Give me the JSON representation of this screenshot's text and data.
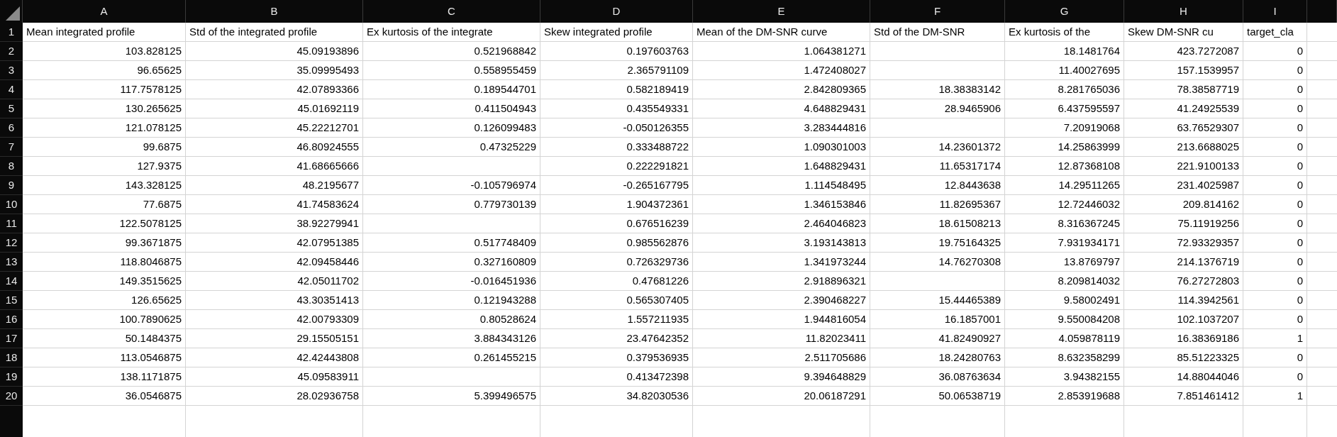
{
  "column_letters": [
    "A",
    "B",
    "C",
    "D",
    "E",
    "F",
    "G",
    "H",
    "I"
  ],
  "header_row": {
    "number": "1",
    "cells": [
      "Mean integrated profile",
      "Std of the integrated profile",
      "Ex kurtosis of the integrate",
      "Skew integrated profile",
      "Mean of the DM-SNR curve",
      "Std of the DM-SNR",
      "Ex kurtosis of the",
      "Skew DM-SNR cu",
      "target_cla"
    ]
  },
  "rows": [
    {
      "number": "2",
      "cells": [
        "103.828125",
        "45.09193896",
        "0.521968842",
        "0.197603763",
        "1.064381271",
        null,
        "18.1481764",
        "423.7272087",
        "0"
      ]
    },
    {
      "number": "3",
      "cells": [
        "96.65625",
        "35.09995493",
        "0.558955459",
        "2.365791109",
        "1.472408027",
        null,
        "11.40027695",
        "157.1539957",
        "0"
      ]
    },
    {
      "number": "4",
      "cells": [
        "117.7578125",
        "42.07893366",
        "0.189544701",
        "0.582189419",
        "2.842809365",
        "18.38383142",
        "8.281765036",
        "78.38587719",
        "0"
      ]
    },
    {
      "number": "5",
      "cells": [
        "130.265625",
        "45.01692119",
        "0.411504943",
        "0.435549331",
        "4.648829431",
        "28.9465906",
        "6.437595597",
        "41.24925539",
        "0"
      ]
    },
    {
      "number": "6",
      "cells": [
        "121.078125",
        "45.22212701",
        "0.126099483",
        "-0.050126355",
        "3.283444816",
        null,
        "7.20919068",
        "63.76529307",
        "0"
      ]
    },
    {
      "number": "7",
      "cells": [
        "99.6875",
        "46.80924555",
        "0.47325229",
        "0.333488722",
        "1.090301003",
        "14.23601372",
        "14.25863999",
        "213.6688025",
        "0"
      ]
    },
    {
      "number": "8",
      "cells": [
        "127.9375",
        "41.68665666",
        null,
        "0.222291821",
        "1.648829431",
        "11.65317174",
        "12.87368108",
        "221.9100133",
        "0"
      ]
    },
    {
      "number": "9",
      "cells": [
        "143.328125",
        "48.2195677",
        "-0.105796974",
        "-0.265167795",
        "1.114548495",
        "12.8443638",
        "14.29511265",
        "231.4025987",
        "0"
      ]
    },
    {
      "number": "10",
      "cells": [
        "77.6875",
        "41.74583624",
        "0.779730139",
        "1.904372361",
        "1.346153846",
        "11.82695367",
        "12.72446032",
        "209.814162",
        "0"
      ]
    },
    {
      "number": "11",
      "cells": [
        "122.5078125",
        "38.92279941",
        null,
        "0.676516239",
        "2.464046823",
        "18.61508213",
        "8.316367245",
        "75.11919256",
        "0"
      ]
    },
    {
      "number": "12",
      "cells": [
        "99.3671875",
        "42.07951385",
        "0.517748409",
        "0.985562876",
        "3.193143813",
        "19.75164325",
        "7.931934171",
        "72.93329357",
        "0"
      ]
    },
    {
      "number": "13",
      "cells": [
        "118.8046875",
        "42.09458446",
        "0.327160809",
        "0.726329736",
        "1.341973244",
        "14.76270308",
        "13.8769797",
        "214.1376719",
        "0"
      ]
    },
    {
      "number": "14",
      "cells": [
        "149.3515625",
        "42.05011702",
        "-0.016451936",
        "0.47681226",
        "2.918896321",
        null,
        "8.209814032",
        "76.27272803",
        "0"
      ]
    },
    {
      "number": "15",
      "cells": [
        "126.65625",
        "43.30351413",
        "0.121943288",
        "0.565307405",
        "2.390468227",
        "15.44465389",
        "9.58002491",
        "114.3942561",
        "0"
      ]
    },
    {
      "number": "16",
      "cells": [
        "100.7890625",
        "42.00793309",
        "0.80528624",
        "1.557211935",
        "1.944816054",
        "16.1857001",
        "9.550084208",
        "102.1037207",
        "0"
      ]
    },
    {
      "number": "17",
      "cells": [
        "50.1484375",
        "29.15505151",
        "3.884343126",
        "23.47642352",
        "11.82023411",
        "41.82490927",
        "4.059878119",
        "16.38369186",
        "1"
      ]
    },
    {
      "number": "18",
      "cells": [
        "113.0546875",
        "42.42443808",
        "0.261455215",
        "0.379536935",
        "2.511705686",
        "18.24280763",
        "8.632358299",
        "85.51223325",
        "0"
      ]
    },
    {
      "number": "19",
      "cells": [
        "138.1171875",
        "45.09583911",
        null,
        "0.413472398",
        "9.394648829",
        "36.08763634",
        "3.94382155",
        "14.88044046",
        "0"
      ]
    },
    {
      "number": "20",
      "cells": [
        "36.0546875",
        "28.02936758",
        "5.399496575",
        "34.82030536",
        "20.06187291",
        "50.06538719",
        "2.853919688",
        "7.851461412",
        "1"
      ]
    }
  ]
}
